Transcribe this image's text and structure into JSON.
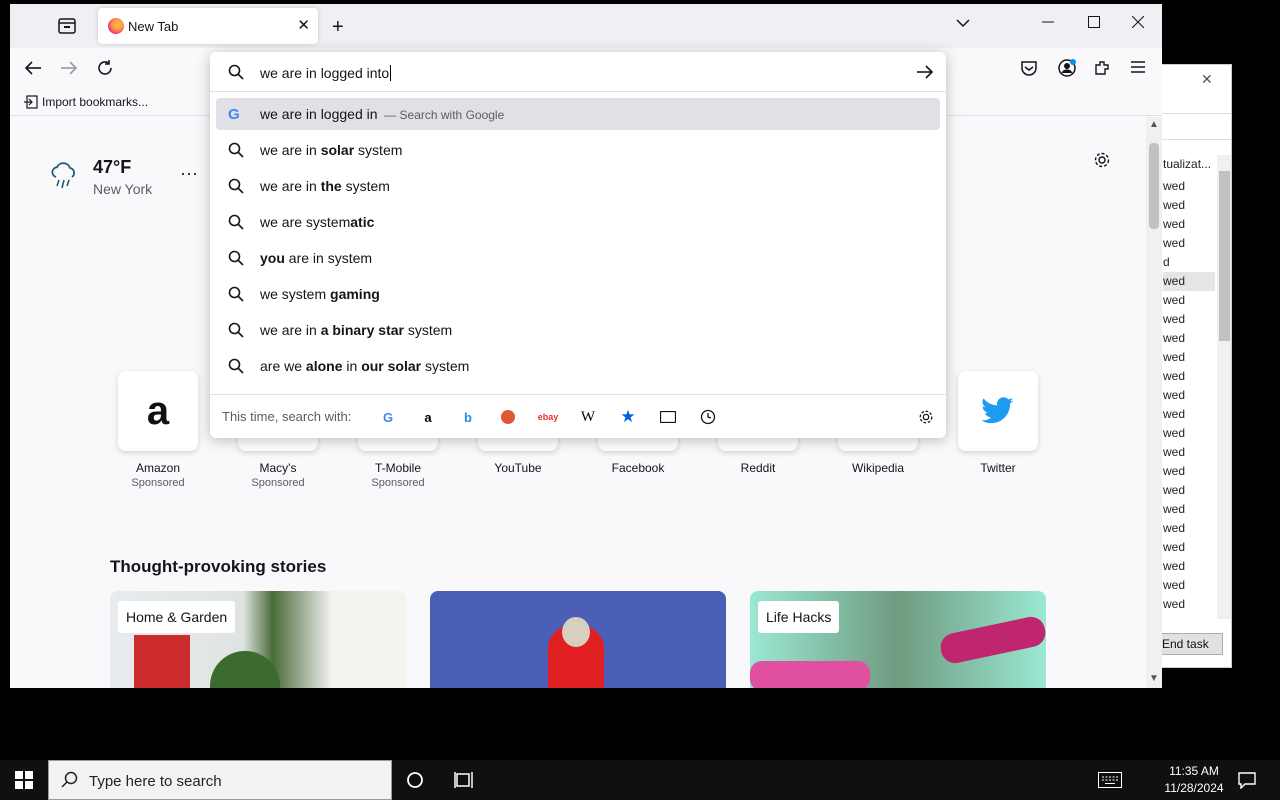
{
  "tab": {
    "title": "New Tab"
  },
  "urlbar": {
    "value": "we are in logged into"
  },
  "bookmarks": {
    "import_label": "Import bookmarks..."
  },
  "weather": {
    "temp": "47°F",
    "city": "New York"
  },
  "suggestions": [
    {
      "pre": "we are in logged in",
      "bold": "",
      "post": "",
      "hint": "— Search with Google",
      "engine": "google"
    },
    {
      "pre": "we are in ",
      "bold": "solar",
      "post": " system"
    },
    {
      "pre": "we are in ",
      "bold": "the",
      "post": " system"
    },
    {
      "pre": "we are system",
      "bold": "atic",
      "post": ""
    },
    {
      "pre": "",
      "bold": "you",
      "post": " are in system"
    },
    {
      "pre": "we system ",
      "bold": "gaming",
      "post": ""
    },
    {
      "pre": "we are in ",
      "bold": "a binary star",
      "post": " system"
    },
    {
      "pre": "are we ",
      "bold": "alone",
      "post": " in ",
      "bold2": "our solar",
      "post2": " system"
    }
  ],
  "oneoff": {
    "label": "This time, search with:"
  },
  "top_sites": [
    {
      "name": "Amazon",
      "sponsored": "Sponsored"
    },
    {
      "name": "Macy's",
      "sponsored": "Sponsored"
    },
    {
      "name": "T-Mobile",
      "sponsored": "Sponsored"
    },
    {
      "name": "YouTube",
      "sponsored": ""
    },
    {
      "name": "Facebook",
      "sponsored": ""
    },
    {
      "name": "Reddit",
      "sponsored": ""
    },
    {
      "name": "Wikipedia",
      "sponsored": ""
    },
    {
      "name": "Twitter",
      "sponsored": ""
    }
  ],
  "stories": {
    "title": "Thought-provoking stories",
    "cards": [
      {
        "tag": "Home & Garden"
      },
      {
        "tag": ""
      },
      {
        "tag": "Life Hacks"
      }
    ]
  },
  "bgwin": {
    "header": "tualizat...",
    "rows": [
      "wed",
      "wed",
      "wed",
      "wed",
      "d",
      "wed",
      "wed",
      "wed",
      "wed",
      "wed",
      "wed",
      "wed",
      "wed",
      "wed",
      "wed",
      "wed",
      "wed",
      "wed",
      "wed",
      "wed",
      "wed",
      "wed",
      "wed"
    ],
    "end_task": "End task"
  },
  "taskbar": {
    "search_placeholder": "Type here to search",
    "time": "11:35 AM",
    "date": "11/28/2024"
  },
  "colors": {
    "accent": "#0061e0",
    "tab_bg": "#f0f0f4",
    "content_bg": "#f9f9fb",
    "selected_row": "#e0e0e6"
  }
}
